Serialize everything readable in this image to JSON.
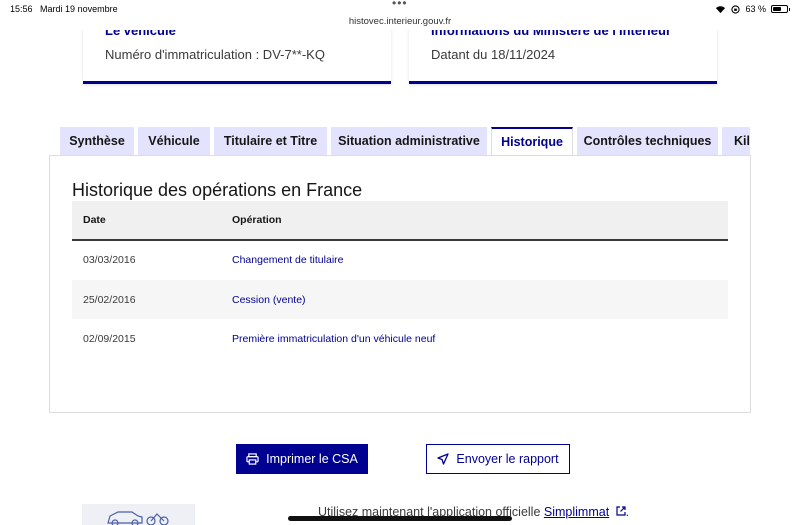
{
  "status_bar": {
    "time": "15:56",
    "date": "Mardi 19 novembre",
    "url": "histovec.interieur.gouv.fr",
    "battery": "63 %",
    "battery_level": 0.63
  },
  "cards": {
    "vehicle": {
      "title": "Le véhicule",
      "text": "Numéro d'immatriculation : DV-7**-KQ"
    },
    "ministry": {
      "title": "Informations du Ministère de l'Intérieur",
      "text": "Datant du 18/11/2024"
    }
  },
  "tabs": [
    {
      "label": "Synthèse"
    },
    {
      "label": "Véhicule"
    },
    {
      "label": "Titulaire et Titre"
    },
    {
      "label": "Situation administrative"
    },
    {
      "label": "Historique"
    },
    {
      "label": "Contrôles techniques"
    },
    {
      "label": "Kilométrage"
    }
  ],
  "history": {
    "title": "Historique des opérations en France",
    "columns": [
      "Date",
      "Opération"
    ],
    "rows": [
      {
        "date": "03/03/2016",
        "operation": "Changement de titulaire"
      },
      {
        "date": "25/02/2016",
        "operation": "Cession (vente)"
      },
      {
        "date": "02/09/2015",
        "operation": "Première immatriculation d'un véhicule neuf"
      }
    ]
  },
  "actions": {
    "print": "Imprimer le CSA",
    "send": "Envoyer le rapport"
  },
  "footer": {
    "text": "Utilisez maintenant l'application officielle ",
    "link": "Simplimmat",
    "end": "."
  },
  "colors": {
    "primary": "#000091",
    "tab_bg": "#e3e3fd",
    "row_alt": "#f6f6f6"
  }
}
